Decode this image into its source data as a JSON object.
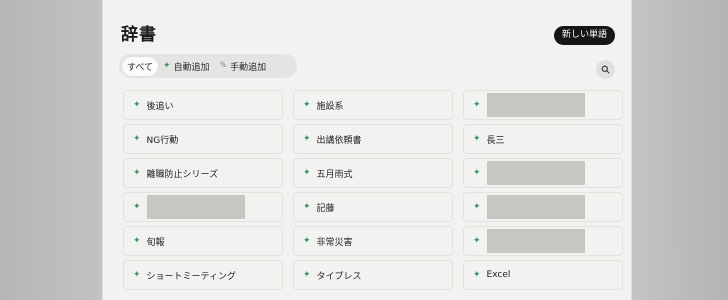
{
  "page_title": "辞書",
  "new_word_button": "新しい単語",
  "filters": [
    {
      "label": "すべて",
      "icon": "none",
      "active": true
    },
    {
      "label": "自動追加",
      "icon": "sparkle-icon",
      "active": false
    },
    {
      "label": "手動追加",
      "icon": "pen-icon",
      "active": false
    }
  ],
  "colors": {
    "accent_green": "#2f9966",
    "button_dark": "#161616",
    "panel_bg": "#f2f2f0"
  },
  "words": {
    "col1": [
      "後追い",
      "NG行動",
      "離職防止シリーズ",
      "",
      "旬報",
      "ショートミーティング"
    ],
    "col2": [
      "施設系",
      "出講依頼書",
      "五月雨式",
      "記藤",
      "非常災害",
      "タイプレス"
    ],
    "col3": [
      "",
      "長三",
      "",
      "",
      "",
      "Excel"
    ]
  }
}
